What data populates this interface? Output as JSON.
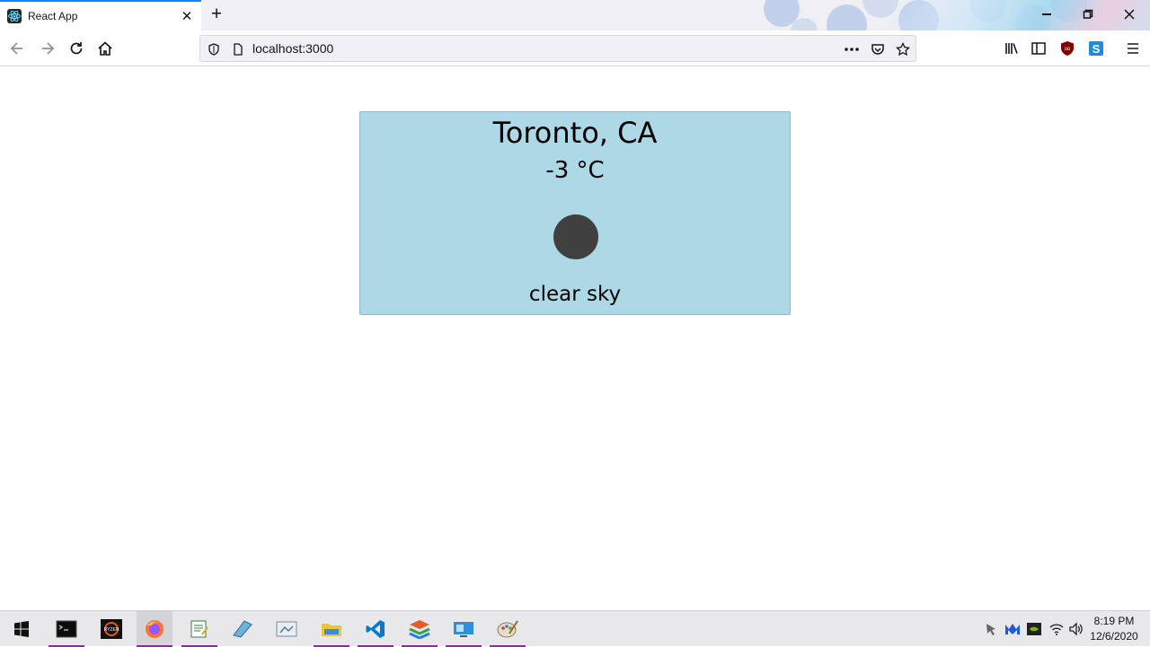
{
  "browser": {
    "tab_title": "React App",
    "url": "localhost:3000"
  },
  "weather": {
    "city": "Toronto, CA",
    "temperature": "-3 °C",
    "description": "clear sky"
  },
  "taskbar": {
    "time": "8:19 PM",
    "date": "12/6/2020"
  },
  "icons": {
    "tab_favicon": "react-icon",
    "taskbar_apps": [
      "start-icon",
      "terminal-icon",
      "ryzen-master-icon",
      "firefox-icon",
      "notepad-icon",
      "paint-icon",
      "screenshot-tool-icon",
      "file-explorer-icon",
      "vscode-icon",
      "layers-app-icon",
      "remote-desktop-icon",
      "paint-palette-icon"
    ]
  },
  "colors": {
    "card_background": "#add8e6",
    "weather_icon": "#404040",
    "tab_accent": "#0a84ff"
  }
}
